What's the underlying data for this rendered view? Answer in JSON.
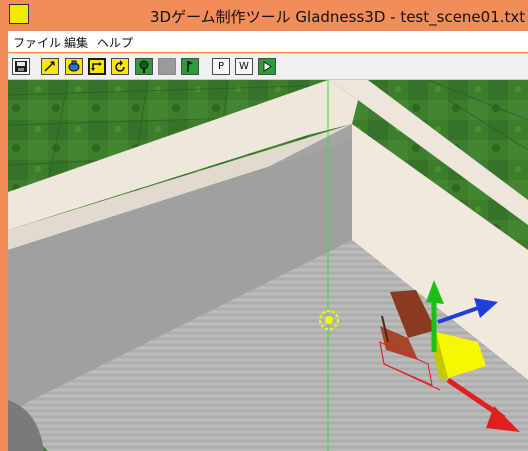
{
  "window": {
    "title": "3Dゲーム制作ツール Gladness3D - test_scene01.txt",
    "icon_label": "Gladness 3D"
  },
  "menu": [
    {
      "label": "ファイル"
    },
    {
      "label": "編集"
    },
    {
      "label": "ヘルプ"
    }
  ],
  "toolbar": {
    "buttons": [
      {
        "icon": "save-icon"
      },
      {
        "icon": "move-arrow-icon"
      },
      {
        "icon": "object-icon"
      },
      {
        "icon": "move-select-icon"
      },
      {
        "icon": "rotate-icon"
      },
      {
        "icon": "tree-icon"
      },
      {
        "icon": "gray-block-icon"
      },
      {
        "icon": "flag-icon"
      },
      {
        "label": "P"
      },
      {
        "label": "W"
      },
      {
        "icon": "play-icon"
      }
    ]
  },
  "colors": {
    "title_bar": "#f28c5a",
    "grass": "#3b7a2a",
    "wall_shadow": "#9c9c9c",
    "wall_light": "#f4ebe0",
    "floor": "#b8b8b8",
    "axis_x": "#e02020",
    "axis_y": "#18c018",
    "axis_z": "#1f3fd8",
    "handle": "#f7f700"
  }
}
